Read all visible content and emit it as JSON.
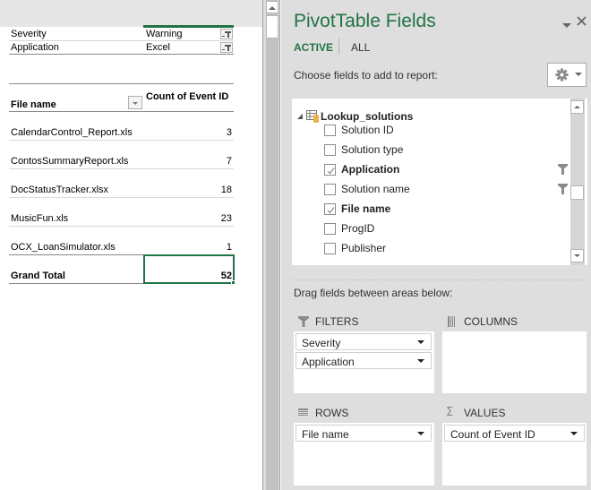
{
  "sheet": {
    "report_filters": [
      {
        "label": "Severity",
        "value": "Warning"
      },
      {
        "label": "Application",
        "value": "Excel"
      }
    ],
    "row_header_label": "File name",
    "value_header_label": "Count of Event ID",
    "rows": [
      {
        "name": "CalendarControl_Report.xls",
        "count": "3"
      },
      {
        "name": "ContosSummaryReport.xls",
        "count": "7"
      },
      {
        "name": "DocStatusTracker.xlsx",
        "count": "18"
      },
      {
        "name": "MusicFun.xls",
        "count": "23"
      },
      {
        "name": "OCX_LoanSimulator.xls",
        "count": "1"
      }
    ],
    "grand_total": {
      "label": "Grand Total",
      "count": "52"
    }
  },
  "pane": {
    "title": "PivotTable Fields",
    "tabs": {
      "active": "ACTIVE",
      "all": "ALL"
    },
    "choose_label": "Choose fields to add to report:",
    "table_name": "Lookup_solutions",
    "fields": [
      {
        "name": "Solution ID",
        "checked": false,
        "filtered": false
      },
      {
        "name": "Solution type",
        "checked": false,
        "filtered": false
      },
      {
        "name": "Application",
        "checked": true,
        "filtered": true
      },
      {
        "name": "Solution name",
        "checked": false,
        "filtered": true
      },
      {
        "name": "File name",
        "checked": true,
        "filtered": false
      },
      {
        "name": "ProgID",
        "checked": false,
        "filtered": false
      },
      {
        "name": "Publisher",
        "checked": false,
        "filtered": false
      }
    ],
    "drag_label": "Drag fields between areas below:",
    "areas": {
      "filters": {
        "label": "FILTERS",
        "items": [
          "Severity",
          "Application"
        ]
      },
      "columns": {
        "label": "COLUMNS",
        "items": []
      },
      "rows": {
        "label": "ROWS",
        "items": [
          "File name"
        ]
      },
      "values": {
        "label": "VALUES",
        "items": [
          "Count of Event ID"
        ]
      }
    }
  },
  "colors": {
    "accent": "#217346",
    "pane_bg": "#dedede"
  }
}
